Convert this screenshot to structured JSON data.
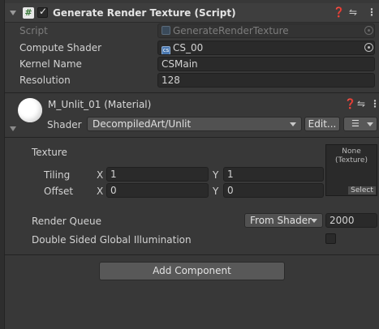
{
  "component": {
    "title": "Generate Render Texture (Script)",
    "enabled": true,
    "script_label": "Script",
    "script_value": "GenerateRenderTexture",
    "fields": [
      {
        "label": "Compute Shader",
        "value": "CS_00"
      },
      {
        "label": "Kernel Name",
        "value": "CSMain"
      },
      {
        "label": "Resolution",
        "value": "128"
      }
    ]
  },
  "material": {
    "title": "M_Unlit_01 (Material)",
    "shader_label": "Shader",
    "shader_value": "DecompiledArt/Unlit",
    "edit_label": "Edit...",
    "texture_label": "Texture",
    "tiling_label": "Tiling",
    "offset_label": "Offset",
    "tiling": {
      "x_label": "X",
      "x": "1",
      "y_label": "Y",
      "y": "1"
    },
    "offset": {
      "x_label": "X",
      "x": "0",
      "y_label": "Y",
      "y": "0"
    },
    "texture_slot_text": "None\n(Texture)",
    "texture_select_label": "Select",
    "render_queue_label": "Render Queue",
    "render_queue_mode": "From Shader",
    "render_queue_value": "2000",
    "double_sided_gi_label": "Double Sided Global Illumination",
    "double_sided_gi": false
  },
  "add_component_label": "Add Component",
  "icons": {
    "header_help": "help-icon",
    "header_presets": "presets-icon",
    "header_menu": "kebab-menu-icon"
  }
}
